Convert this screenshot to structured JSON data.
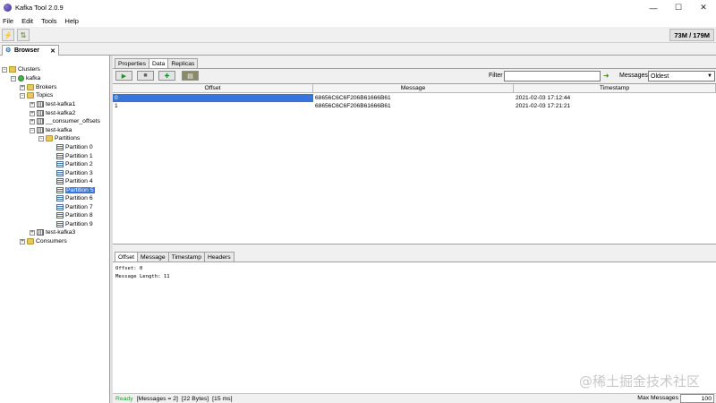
{
  "window": {
    "title": "Kafka Tool  2.0.9",
    "minimize": "—",
    "maximize": "☐",
    "close": "✕"
  },
  "menu": [
    "File",
    "Edit",
    "Tools",
    "Help"
  ],
  "toolbar": {
    "memory": "73M / 179M"
  },
  "browser_tab": {
    "label": "Browser",
    "close": "✕"
  },
  "tree": {
    "clusters": "Clusters",
    "kafka": "kafka",
    "brokers": "Brokers",
    "topics": "Topics",
    "topic_list": [
      "test-kafka1",
      "test-kafka2",
      "__consumer_offsets",
      "test-kafka"
    ],
    "partitions_folder": "Partitions",
    "partitions": [
      "Partition 0",
      "Partition 1",
      "Partition 2",
      "Partition 3",
      "Partition 4",
      "Partition 5",
      "Partition 6",
      "Partition 7",
      "Partition 8",
      "Partition 9"
    ],
    "selected_partition": "Partition 5",
    "topic_after": "test-kafka3",
    "consumers": "Consumers"
  },
  "subtabs": [
    "Properties",
    "Data",
    "Replicas"
  ],
  "active_subtab": "Data",
  "filter": {
    "label": "Filter",
    "value": "",
    "messages_label": "Messages",
    "messages_value": "Oldest"
  },
  "table": {
    "headers": [
      "Offset",
      "Message",
      "Timestamp"
    ],
    "rows": [
      {
        "offset": "0",
        "message": "68656C6C6F206B61666B61",
        "timestamp": "2021-02-03 17:12:44"
      },
      {
        "offset": "1",
        "message": "68656C6C6F206B61666B61",
        "timestamp": "2021-02-03 17:21:21"
      }
    ]
  },
  "detail_tabs": [
    "Offset",
    "Message",
    "Timestamp",
    "Headers"
  ],
  "detail": {
    "line1": "Offset: 0",
    "line2": "Message Length: 11"
  },
  "status": {
    "ready": "Ready",
    "messages": "[Messages = 2]",
    "bytes": "[22 Bytes]",
    "time": "[15 ms]",
    "max_label": "Max Messages",
    "max_value": "100"
  },
  "watermark": "@稀土掘金技术社区",
  "colors": {
    "selection": "#3875d7",
    "ready": "#2a9a2a"
  }
}
